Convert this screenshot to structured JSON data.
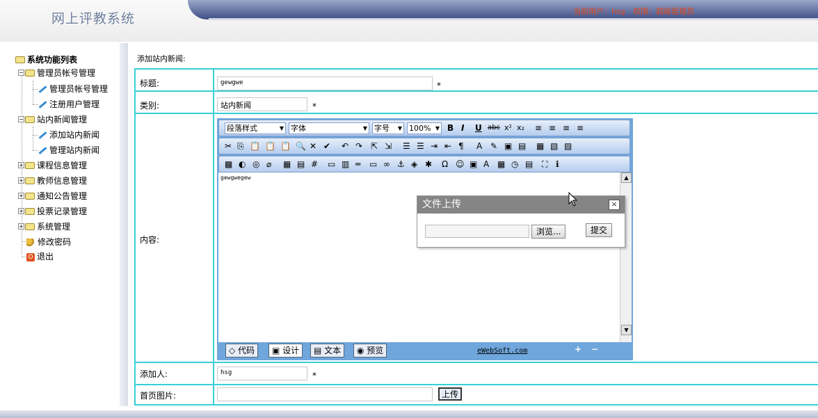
{
  "header": {
    "logo": "网上评教系统",
    "current_user_label": "当前用户：hsg",
    "permission_label": "权限：超级管理员"
  },
  "sidebar": {
    "title": "系统功能列表",
    "groups": [
      {
        "label": "管理员帐号管理",
        "children": [
          "管理员帐号管理",
          "注册用户管理"
        ]
      },
      {
        "label": "站内新闻管理",
        "children": [
          "添加站内新闻",
          "管理站内新闻"
        ]
      },
      {
        "label": "课程信息管理"
      },
      {
        "label": "教师信息管理"
      },
      {
        "label": "通知公告管理"
      },
      {
        "label": "投票记录管理"
      },
      {
        "label": "系统管理"
      }
    ],
    "change_password": "修改密码",
    "logout": "退出"
  },
  "page": {
    "heading": "添加站内新闻:"
  },
  "form": {
    "title_label": "标题:",
    "title_value": "gewgwe",
    "category_label": "类别:",
    "category_value": "站内新闻",
    "content_label": "内容:",
    "content_value": "gewgwegew",
    "author_label": "添加人:",
    "author_value": "hsg",
    "image_label": "首页图片:",
    "image_value": "",
    "upload_button": "上传",
    "required_mark": "*"
  },
  "editor": {
    "paragraph_style": "段落样式",
    "font": "字体",
    "font_size": "字号",
    "zoom": "100%",
    "modes": [
      "代码",
      "设计",
      "文本",
      "预览"
    ],
    "copyright": "eWebSoft.com"
  },
  "dialog": {
    "title": "文件上传",
    "close": "×",
    "browse_button": "浏览...",
    "submit_button": "提交"
  },
  "colors": {
    "accent_line": "#38cfd8",
    "header_bar": "#3e4d86",
    "user_info": "#e0461a",
    "editor_frame": "#6fa6dc"
  }
}
